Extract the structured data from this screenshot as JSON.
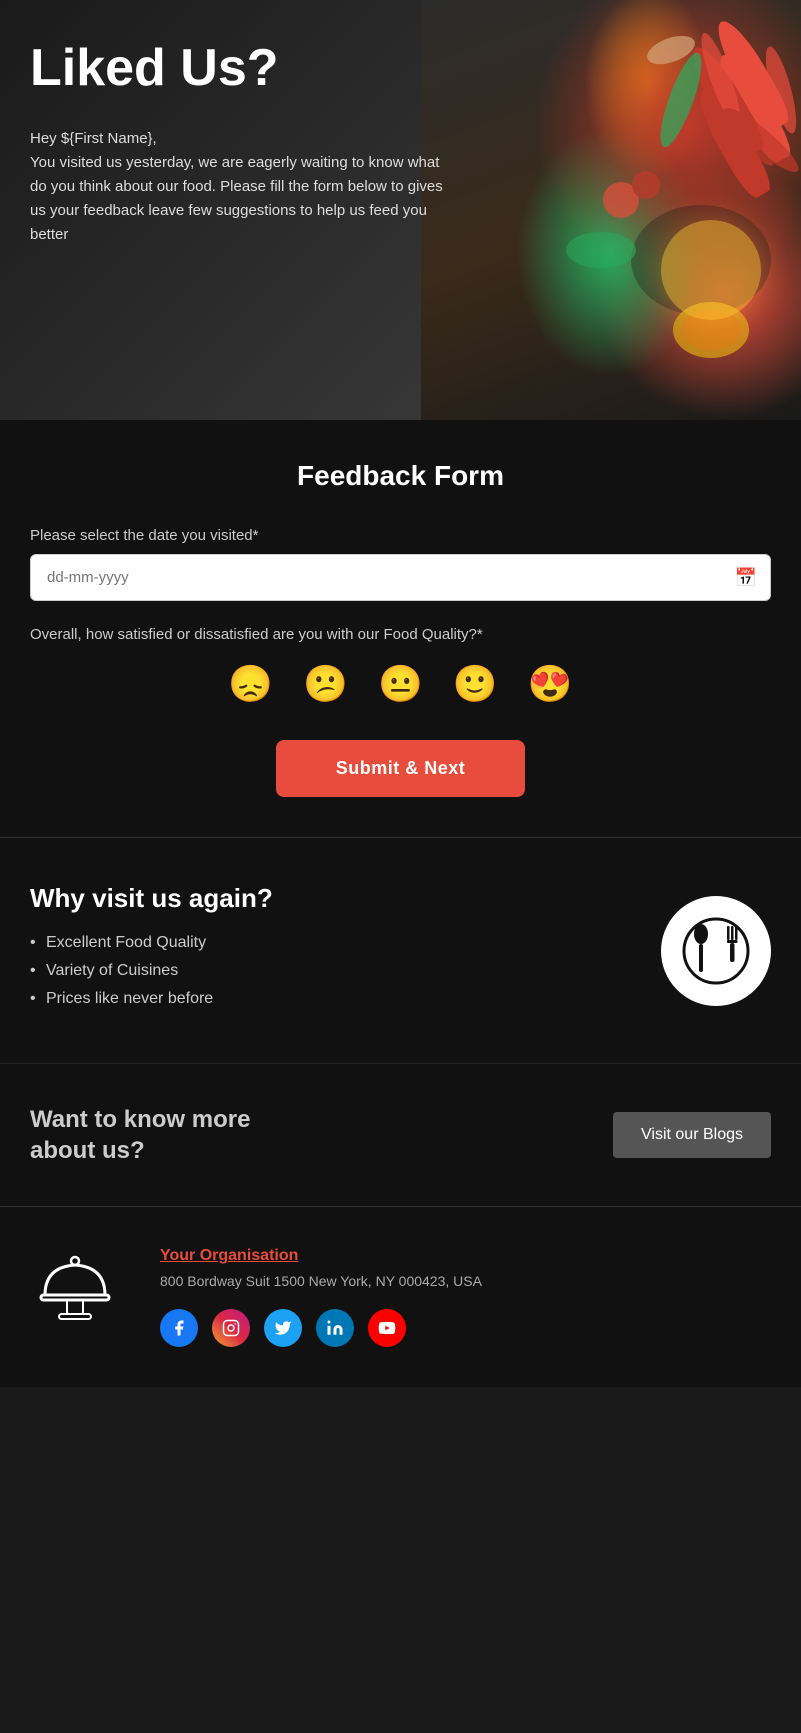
{
  "hero": {
    "title": "Liked Us?",
    "greeting": "Hey ${First Name},",
    "description": "You visited us yesterday, we are eagerly waiting to know what do you think about our food. Please fill the form below to gives us your feedback leave few suggestions to help us feed you better"
  },
  "form": {
    "title": "Feedback Form",
    "date_label": "Please select the date you visited*",
    "date_placeholder": "dd-mm-yyyy",
    "satisfaction_label": "Overall, how satisfied or dissatisfied are you with our Food Quality?*",
    "emojis": [
      {
        "symbol": "😞",
        "label": "very-dissatisfied"
      },
      {
        "symbol": "😕",
        "label": "dissatisfied"
      },
      {
        "symbol": "😐",
        "label": "neutral"
      },
      {
        "symbol": "🙂",
        "label": "satisfied"
      },
      {
        "symbol": "😍",
        "label": "very-satisfied"
      }
    ],
    "submit_label": "Submit & Next"
  },
  "why": {
    "title": "Why visit us again?",
    "reasons": [
      "Excellent Food Quality",
      "Variety of Cuisines",
      "Prices like never before"
    ]
  },
  "blogs": {
    "text": "Want to know more about us?",
    "button_label": "Visit our Blogs"
  },
  "footer": {
    "org_name": "Your Organisation",
    "address": "800 Bordway Suit 1500 New York, NY 000423, USA",
    "social": [
      {
        "name": "facebook",
        "class": "social-fb",
        "symbol": "f"
      },
      {
        "name": "instagram",
        "class": "social-ig",
        "symbol": "📷"
      },
      {
        "name": "twitter",
        "class": "social-tw",
        "symbol": "🐦"
      },
      {
        "name": "linkedin",
        "class": "social-li",
        "symbol": "in"
      },
      {
        "name": "youtube",
        "class": "social-yt",
        "symbol": "▶"
      }
    ]
  }
}
